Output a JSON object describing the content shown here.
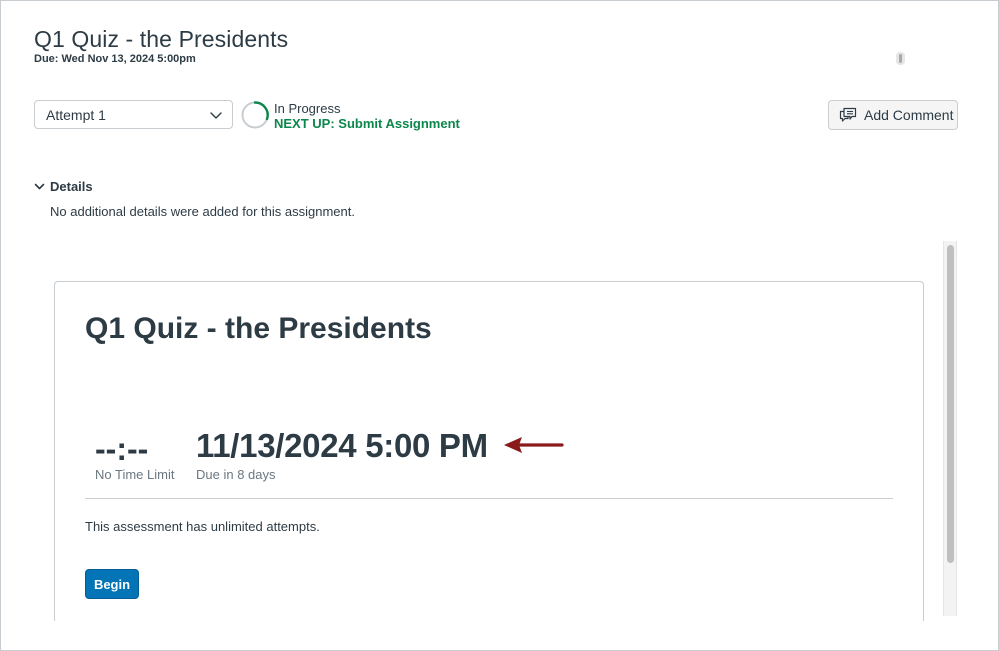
{
  "header": {
    "title": "Q1 Quiz - the Presidents",
    "due": "Due: Wed Nov 13, 2024 5:00pm"
  },
  "toolbar": {
    "attempt_select": {
      "value": "Attempt 1",
      "icon": "chevron-down-icon"
    },
    "status": "In Progress",
    "next_up": "NEXT UP: Submit Assignment",
    "add_comment_label": "Add Comment",
    "add_comment_icon": "comment-icon"
  },
  "details": {
    "toggle_label": "Details",
    "text": "No additional details were added for this assignment."
  },
  "quiz": {
    "title": "Q1 Quiz - the Presidents",
    "time_value": "--:--",
    "time_label": "No Time Limit",
    "due_value": "11/13/2024 5:00 PM",
    "due_label": "Due in 8 days",
    "attempts_text": "This assessment has unlimited attempts.",
    "begin_label": "Begin"
  },
  "colors": {
    "accent_green": "#0b874b",
    "button_blue": "#0374b5",
    "text_dark": "#2d3b45",
    "text_muted": "#6b7780",
    "annotation_arrow": "#8b1a1a"
  }
}
